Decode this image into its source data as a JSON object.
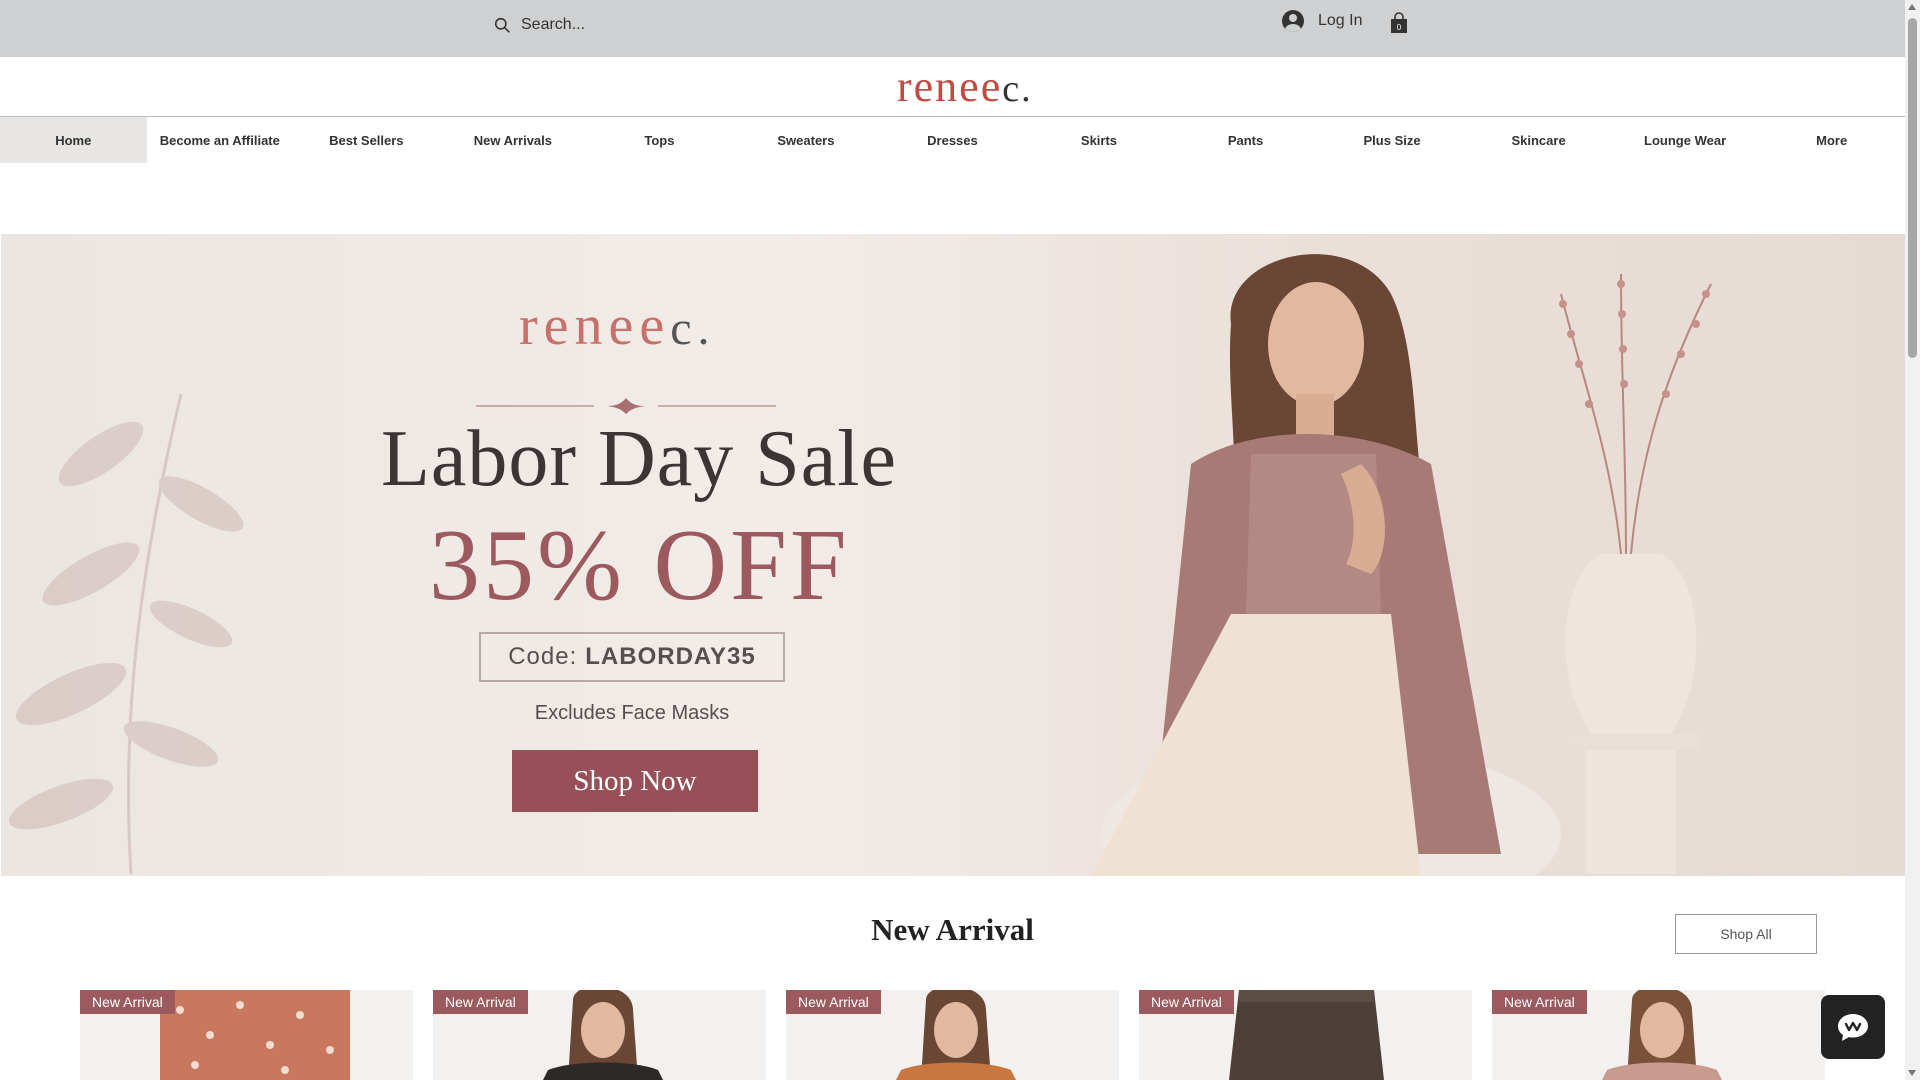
{
  "header": {
    "search_placeholder": "Search...",
    "login_label": "Log In",
    "cart_count": "0"
  },
  "brand": {
    "logo_main": "renee",
    "logo_end": "c."
  },
  "nav": {
    "items": [
      {
        "label": "Home"
      },
      {
        "label": "Become an Affiliate"
      },
      {
        "label": "Best Sellers"
      },
      {
        "label": "New Arrivals"
      },
      {
        "label": "Tops"
      },
      {
        "label": "Sweaters"
      },
      {
        "label": "Dresses"
      },
      {
        "label": "Skirts"
      },
      {
        "label": "Pants"
      },
      {
        "label": "Plus Size"
      },
      {
        "label": "Skincare"
      },
      {
        "label": "Lounge Wear"
      },
      {
        "label": "More"
      }
    ],
    "active_index": 0
  },
  "hero": {
    "logo_main": "renee",
    "logo_end": "c.",
    "title": "Labor Day Sale",
    "discount": "35% OFF",
    "code_label": "Code:",
    "code_value": "LABORDAY35",
    "note": "Excludes Face Masks",
    "cta_label": "Shop Now"
  },
  "new_arrival": {
    "title": "New Arrival",
    "shop_all_label": "Shop All",
    "products": [
      {
        "badge": "New Arrival",
        "thumb": "floral-skirt"
      },
      {
        "badge": "New Arrival",
        "thumb": "model-dark-top"
      },
      {
        "badge": "New Arrival",
        "thumb": "model-orange-top"
      },
      {
        "badge": "New Arrival",
        "thumb": "brown-pants"
      },
      {
        "badge": "New Arrival",
        "thumb": "model-pink-top"
      }
    ]
  },
  "colors": {
    "brand_red": "#c24a42",
    "hero_accent": "#975058",
    "badge": "#9c5a5f",
    "topbar": "#cfd0d1"
  }
}
